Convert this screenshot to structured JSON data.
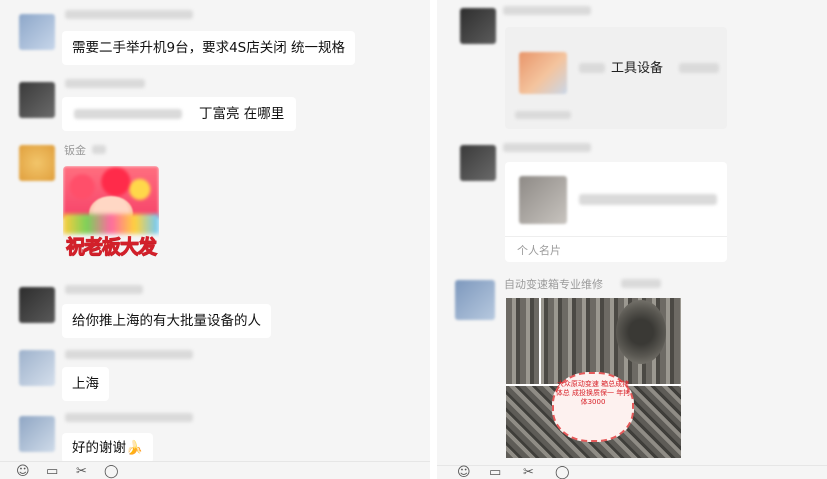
{
  "left": {
    "messages": [
      {
        "text": "需要二手举升机9台，要求4S店关闭 统一规格"
      },
      {
        "text": "丁富亮 在哪里"
      },
      {
        "sender": "钣金"
      },
      {
        "sticker_text": "祝老板大发"
      },
      {
        "text": "给你推上海的有大批量设备的人"
      },
      {
        "text": "上海"
      },
      {
        "text": "好的谢谢🍌"
      }
    ],
    "toolbar_icons": [
      "emoji-icon",
      "folder-icon",
      "scissors-icon",
      "chat-icon"
    ]
  },
  "right": {
    "link_card": {
      "title": "工具设备"
    },
    "contact_card": {
      "footer": "个人名片"
    },
    "sender_name": "自动变速箱专业维修",
    "photo_caption": "大众原动变速 箱总成拷体总 成投换质保一 年拷体3000",
    "toolbar_icons": [
      "emoji-icon",
      "folder-icon",
      "scissors-icon",
      "chat-icon"
    ]
  },
  "colors": {
    "background": "#f5f5f5",
    "bubble": "#ffffff",
    "name_text": "#9b9b9b"
  }
}
